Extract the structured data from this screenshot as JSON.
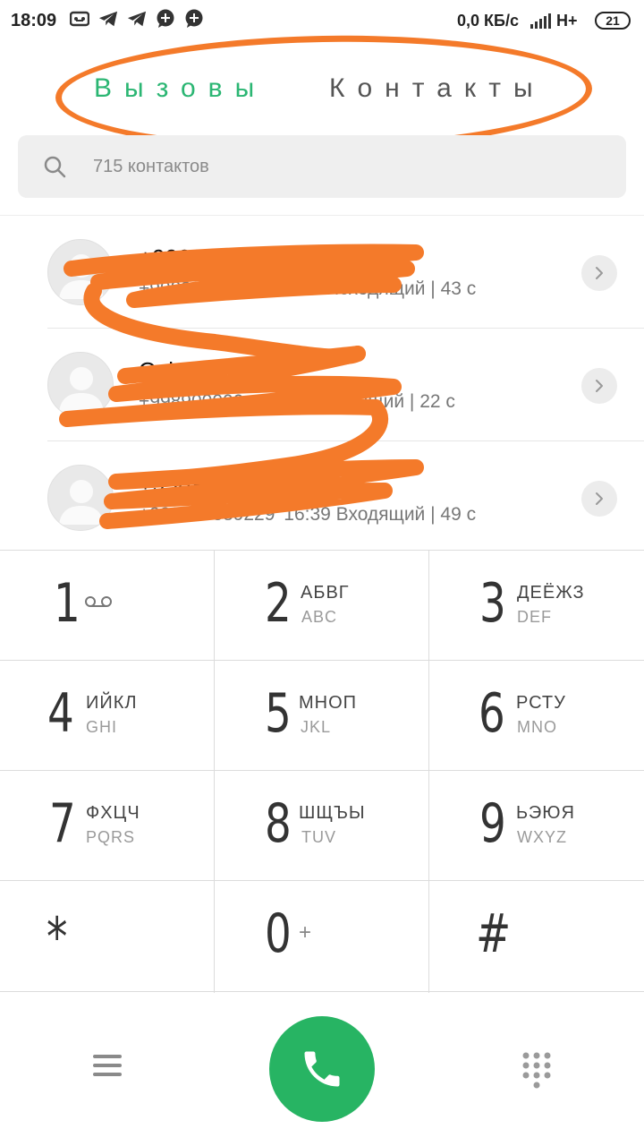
{
  "status_bar": {
    "time": "18:09",
    "net_speed": "0,0 КБ/с",
    "network_type": "H+",
    "battery": "21"
  },
  "tabs": [
    {
      "label": "Вызовы",
      "active": true
    },
    {
      "label": "Контакты",
      "active": false
    }
  ],
  "search": {
    "placeholder": "715 контактов"
  },
  "calls": [
    {
      "name": "+99890049577",
      "number": "+99890049577",
      "time": "16:54",
      "direction": "Исходящий",
      "duration": "43 с"
    },
    {
      "name": "Oyi",
      "number": "+998900000",
      "time": "16:46",
      "direction": "Исходящий",
      "duration": "22 с"
    },
    {
      "name": "+99899",
      "number": "+998998889229",
      "time": "16:39",
      "direction": "Входящий",
      "duration": "49 с"
    }
  ],
  "keypad": {
    "k1": {
      "digit": "1",
      "l1": "",
      "l2": ""
    },
    "k2": {
      "digit": "2",
      "l1": "АБВГ",
      "l2": "ABC"
    },
    "k3": {
      "digit": "3",
      "l1": "ДЕЁЖЗ",
      "l2": "DEF"
    },
    "k4": {
      "digit": "4",
      "l1": "ИЙКЛ",
      "l2": "GHI"
    },
    "k5": {
      "digit": "5",
      "l1": "МНОП",
      "l2": "JKL"
    },
    "k6": {
      "digit": "6",
      "l1": "РСТУ",
      "l2": "MNO"
    },
    "k7": {
      "digit": "7",
      "l1": "ФХЦЧ",
      "l2": "PQRS"
    },
    "k8": {
      "digit": "8",
      "l1": "ШЩЪЫ",
      "l2": "TUV"
    },
    "k9": {
      "digit": "9",
      "l1": "ЬЭЮЯ",
      "l2": "WXYZ"
    },
    "kstar": {
      "digit": "*"
    },
    "k0": {
      "digit": "0",
      "plus": "+"
    },
    "khash": {
      "digit": "#"
    }
  },
  "colors": {
    "accent": "#2bb673",
    "call_button": "#27b463",
    "annotation": "#f47a2a"
  },
  "icons": [
    "video-icon",
    "telegram-icon",
    "telegram-icon",
    "chat-plus-icon",
    "chat-plus-icon",
    "signal-icon",
    "search-icon",
    "chevron-right-icon",
    "voicemail-icon",
    "menu-icon",
    "phone-icon",
    "dialpad-icon"
  ]
}
